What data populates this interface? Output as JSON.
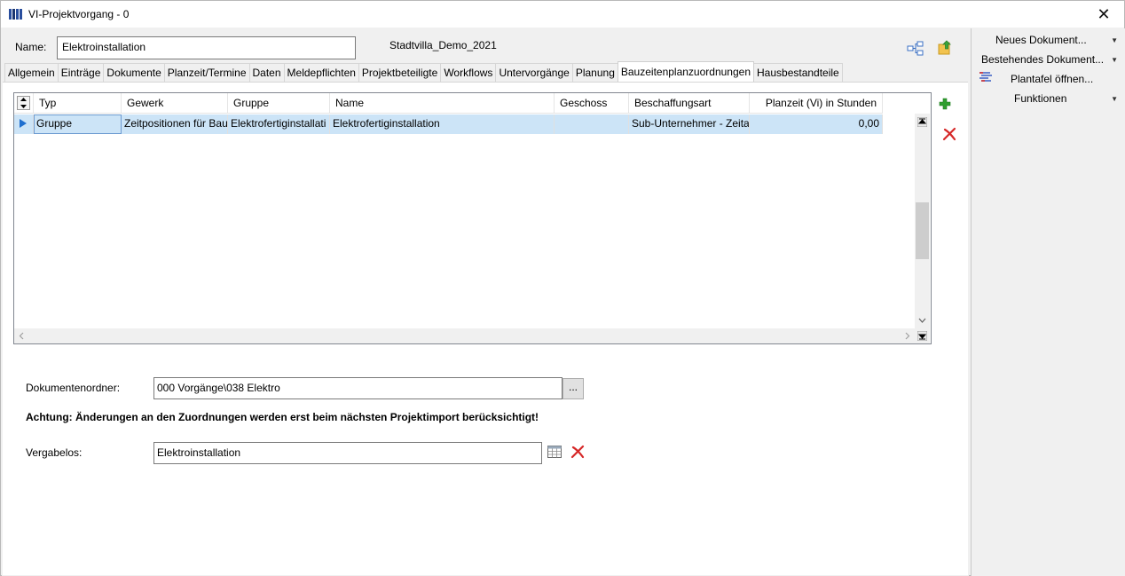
{
  "window": {
    "title": "VI-Projektvorgang - 0",
    "close_glyph": "✕"
  },
  "header": {
    "name_label": "Name:",
    "name_value": "Elektroinstallation",
    "project": "Stadtvilla_Demo_2021"
  },
  "tabs": [
    {
      "label": "Allgemein"
    },
    {
      "label": "Einträge"
    },
    {
      "label": "Dokumente"
    },
    {
      "label": "Planzeit/Termine"
    },
    {
      "label": "Daten"
    },
    {
      "label": "Meldepflichten"
    },
    {
      "label": "Projektbeteiligte"
    },
    {
      "label": "Workflows"
    },
    {
      "label": "Untervorgänge"
    },
    {
      "label": "Planung"
    },
    {
      "label": "Bauzeitenplanzuordnungen"
    },
    {
      "label": "Hausbestandteile"
    }
  ],
  "active_tab": "Bauzeitenplanzuordnungen",
  "grid": {
    "columns": [
      "Typ",
      "Gewerk",
      "Gruppe",
      "Name",
      "Geschoss",
      "Beschaffungsart",
      "Planzeit (Vi) in Stunden"
    ],
    "rows": [
      [
        "Gruppe",
        "Zeitpositionen für Bau",
        "Elektrofertiginstallati",
        "Elektrofertiginstallation",
        "",
        "Sub-Unternehmer - Zeita",
        "0,00"
      ]
    ]
  },
  "form": {
    "docfolder_label": "Dokumentenordner:",
    "docfolder_value": "000 Vorgänge\\038 Elektro",
    "browse_label": "...",
    "warning": "Achtung: Änderungen an den Zuordnungen werden erst beim nächsten Projektimport berücksichtigt!",
    "vergabelos_label": "Vergabelos:",
    "vergabelos_value": "Elektroinstallation"
  },
  "side_menu": [
    {
      "label": "Neues Dokument...",
      "has_dropdown": true
    },
    {
      "label": "Bestehendes Dokument...",
      "has_dropdown": true
    },
    {
      "label": "Plantafel öffnen...",
      "has_dropdown": false,
      "icon": "plantafel-icon"
    },
    {
      "label": "Funktionen",
      "has_dropdown": true
    }
  ],
  "colors": {
    "selection": "#cce4f7",
    "add_green": "#2e9e2e",
    "delete_red": "#d62828",
    "accent_blue": "#2a4f9e"
  }
}
